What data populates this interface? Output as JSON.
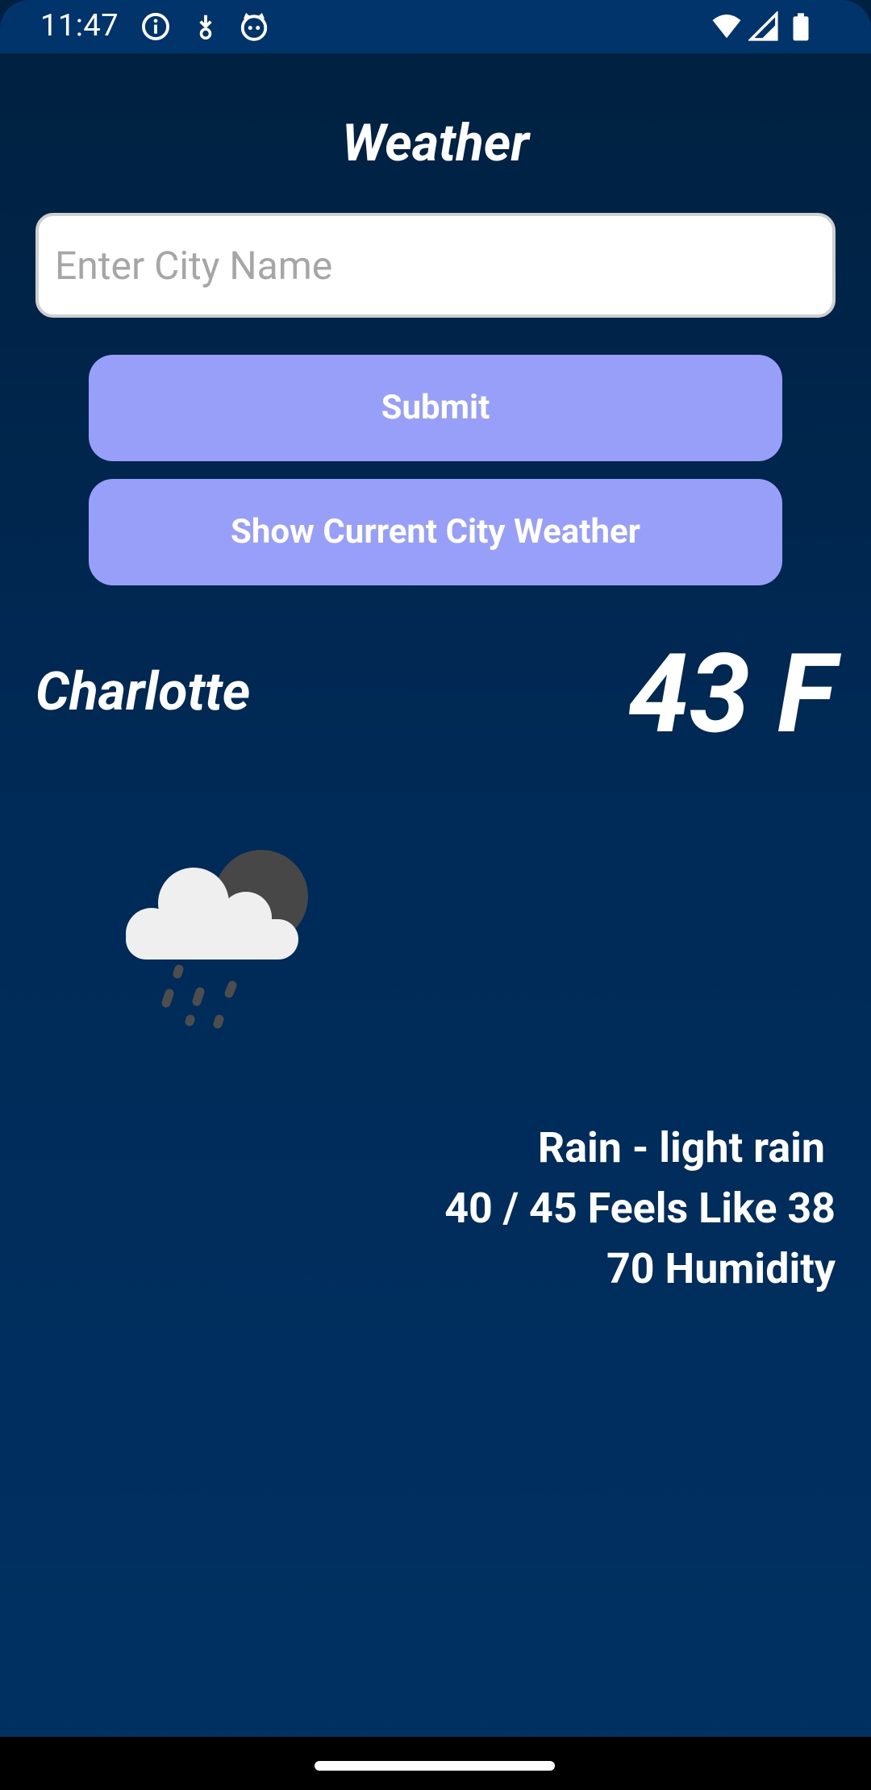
{
  "status_bar": {
    "time": "11:47",
    "left_icons": [
      "info-icon",
      "download-icon",
      "cat-face-icon"
    ],
    "right_icons": [
      "wifi-icon",
      "signal-icon",
      "battery-icon"
    ]
  },
  "app": {
    "title": "Weather"
  },
  "search": {
    "value": "",
    "placeholder": "Enter City Name"
  },
  "buttons": {
    "submit_label": "Submit",
    "current_city_label": "Show Current City Weather"
  },
  "weather": {
    "city": "Charlotte",
    "temperature": "43 F",
    "condition": "Rain - light rain ",
    "range_feels": "40 / 45 Feels Like 38",
    "humidity": "70 Humidity",
    "icon": "cloud-rain-moon-icon"
  },
  "colors": {
    "background_top": "#00203f",
    "background_bottom": "#003163",
    "status_bar": "#00346b",
    "button": "#979ff8",
    "text": "#ffffff"
  }
}
